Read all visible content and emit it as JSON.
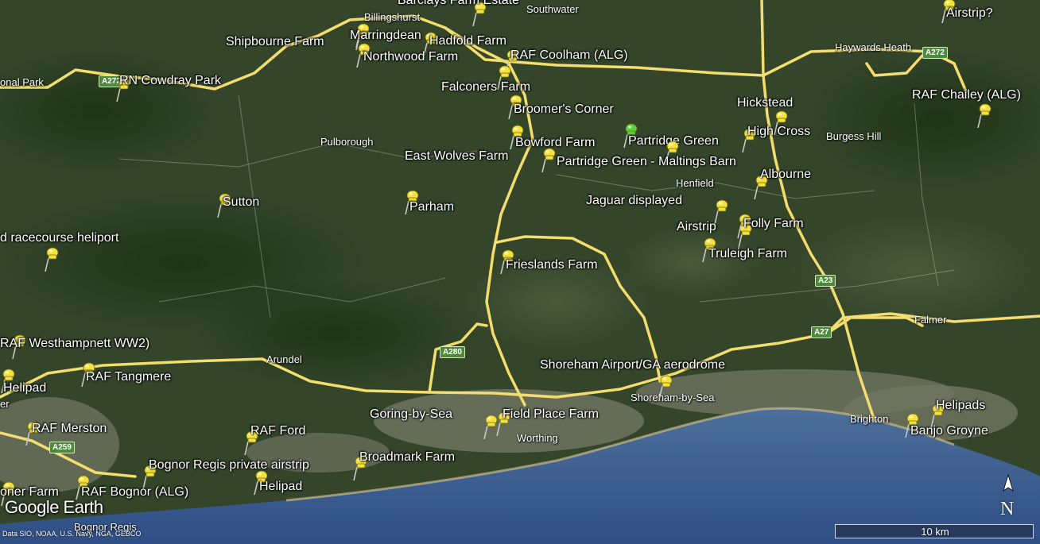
{
  "attribution": "Data SIO, NOAA, U.S. Navy, NGA, GEBCO",
  "logo": "Google Earth",
  "scale_label": "10 km",
  "north_label": "N",
  "colors": {
    "road": "#f2dd6e",
    "sea": "#3a5a8a",
    "land": "#2e3d22",
    "town": "#8a8f7a",
    "pin": "#f4e23a",
    "pin_selected": "#5ad23a"
  },
  "pins": [
    {
      "label": "Barclays Farm Estate",
      "selected": false
    },
    {
      "label": "Airstrip?",
      "selected": false
    },
    {
      "label": "Shipbourne Farm",
      "selected": false
    },
    {
      "label": "Marringdean",
      "selected": false
    },
    {
      "label": "Hadfold Farm",
      "selected": false
    },
    {
      "label": "Northwood Farm",
      "selected": false
    },
    {
      "label": "RAF Coolham (ALG)",
      "selected": false
    },
    {
      "label": "RN Cowdray Park",
      "selected": false
    },
    {
      "label": "Falconers Farm",
      "selected": false
    },
    {
      "label": "Broomer's Corner",
      "selected": false
    },
    {
      "label": "Hickstead",
      "selected": false
    },
    {
      "label": "RAF Chailey (ALG)",
      "selected": false
    },
    {
      "label": "High Cross",
      "selected": false
    },
    {
      "label": "Partridge Green",
      "selected": true
    },
    {
      "label": "Bowford Farm",
      "selected": false
    },
    {
      "label": "Partridge Green - Maltings Barn",
      "selected": false
    },
    {
      "label": "East Wolves Farm",
      "selected": false
    },
    {
      "label": "Albourne",
      "selected": false
    },
    {
      "label": "Sutton",
      "selected": false
    },
    {
      "label": "Parham",
      "selected": false
    },
    {
      "label": "Jaguar displayed",
      "selected": false
    },
    {
      "label": "Airstrip",
      "selected": false
    },
    {
      "label": "Folly Farm",
      "selected": false
    },
    {
      "label": "Truleigh Farm",
      "selected": false
    },
    {
      "label": "d racecourse heliport",
      "selected": false
    },
    {
      "label": "Frieslands Farm",
      "selected": false
    },
    {
      "label": "RAF Westhampnett WW2)",
      "selected": false
    },
    {
      "label": "RAF Tangmere",
      "selected": false
    },
    {
      "label": "Shoreham Airport/GA aerodrome",
      "selected": false
    },
    {
      "label": "Helipad",
      "selected": false
    },
    {
      "label": "Helipads",
      "selected": false
    },
    {
      "label": "Goring-by-Sea",
      "selected": false
    },
    {
      "label": "Field Place Farm",
      "selected": false
    },
    {
      "label": "Banjo Groyne",
      "selected": false
    },
    {
      "label": "RAF Merston",
      "selected": false
    },
    {
      "label": "RAF Ford",
      "selected": false
    },
    {
      "label": "Bognor Regis private airstrip",
      "selected": false
    },
    {
      "label": "Broadmark Farm",
      "selected": false
    },
    {
      "label": "Helipad",
      "selected": false
    },
    {
      "label": "RAF Bognor (ALG)",
      "selected": false
    },
    {
      "label": "oner Farm",
      "selected": false
    }
  ],
  "towns": [
    "Billingshurst",
    "Southwater",
    "Haywards Heath",
    "onal Park",
    "Pulborough",
    "Burgess Hill",
    "Henfield",
    "Arundel",
    "Falmer",
    "Shoreham-by-Sea",
    "Worthing",
    "Brighton",
    "Bognor Regis",
    "er"
  ],
  "roads": [
    "A272",
    "A272",
    "A23",
    "A27",
    "A280",
    "A259"
  ]
}
